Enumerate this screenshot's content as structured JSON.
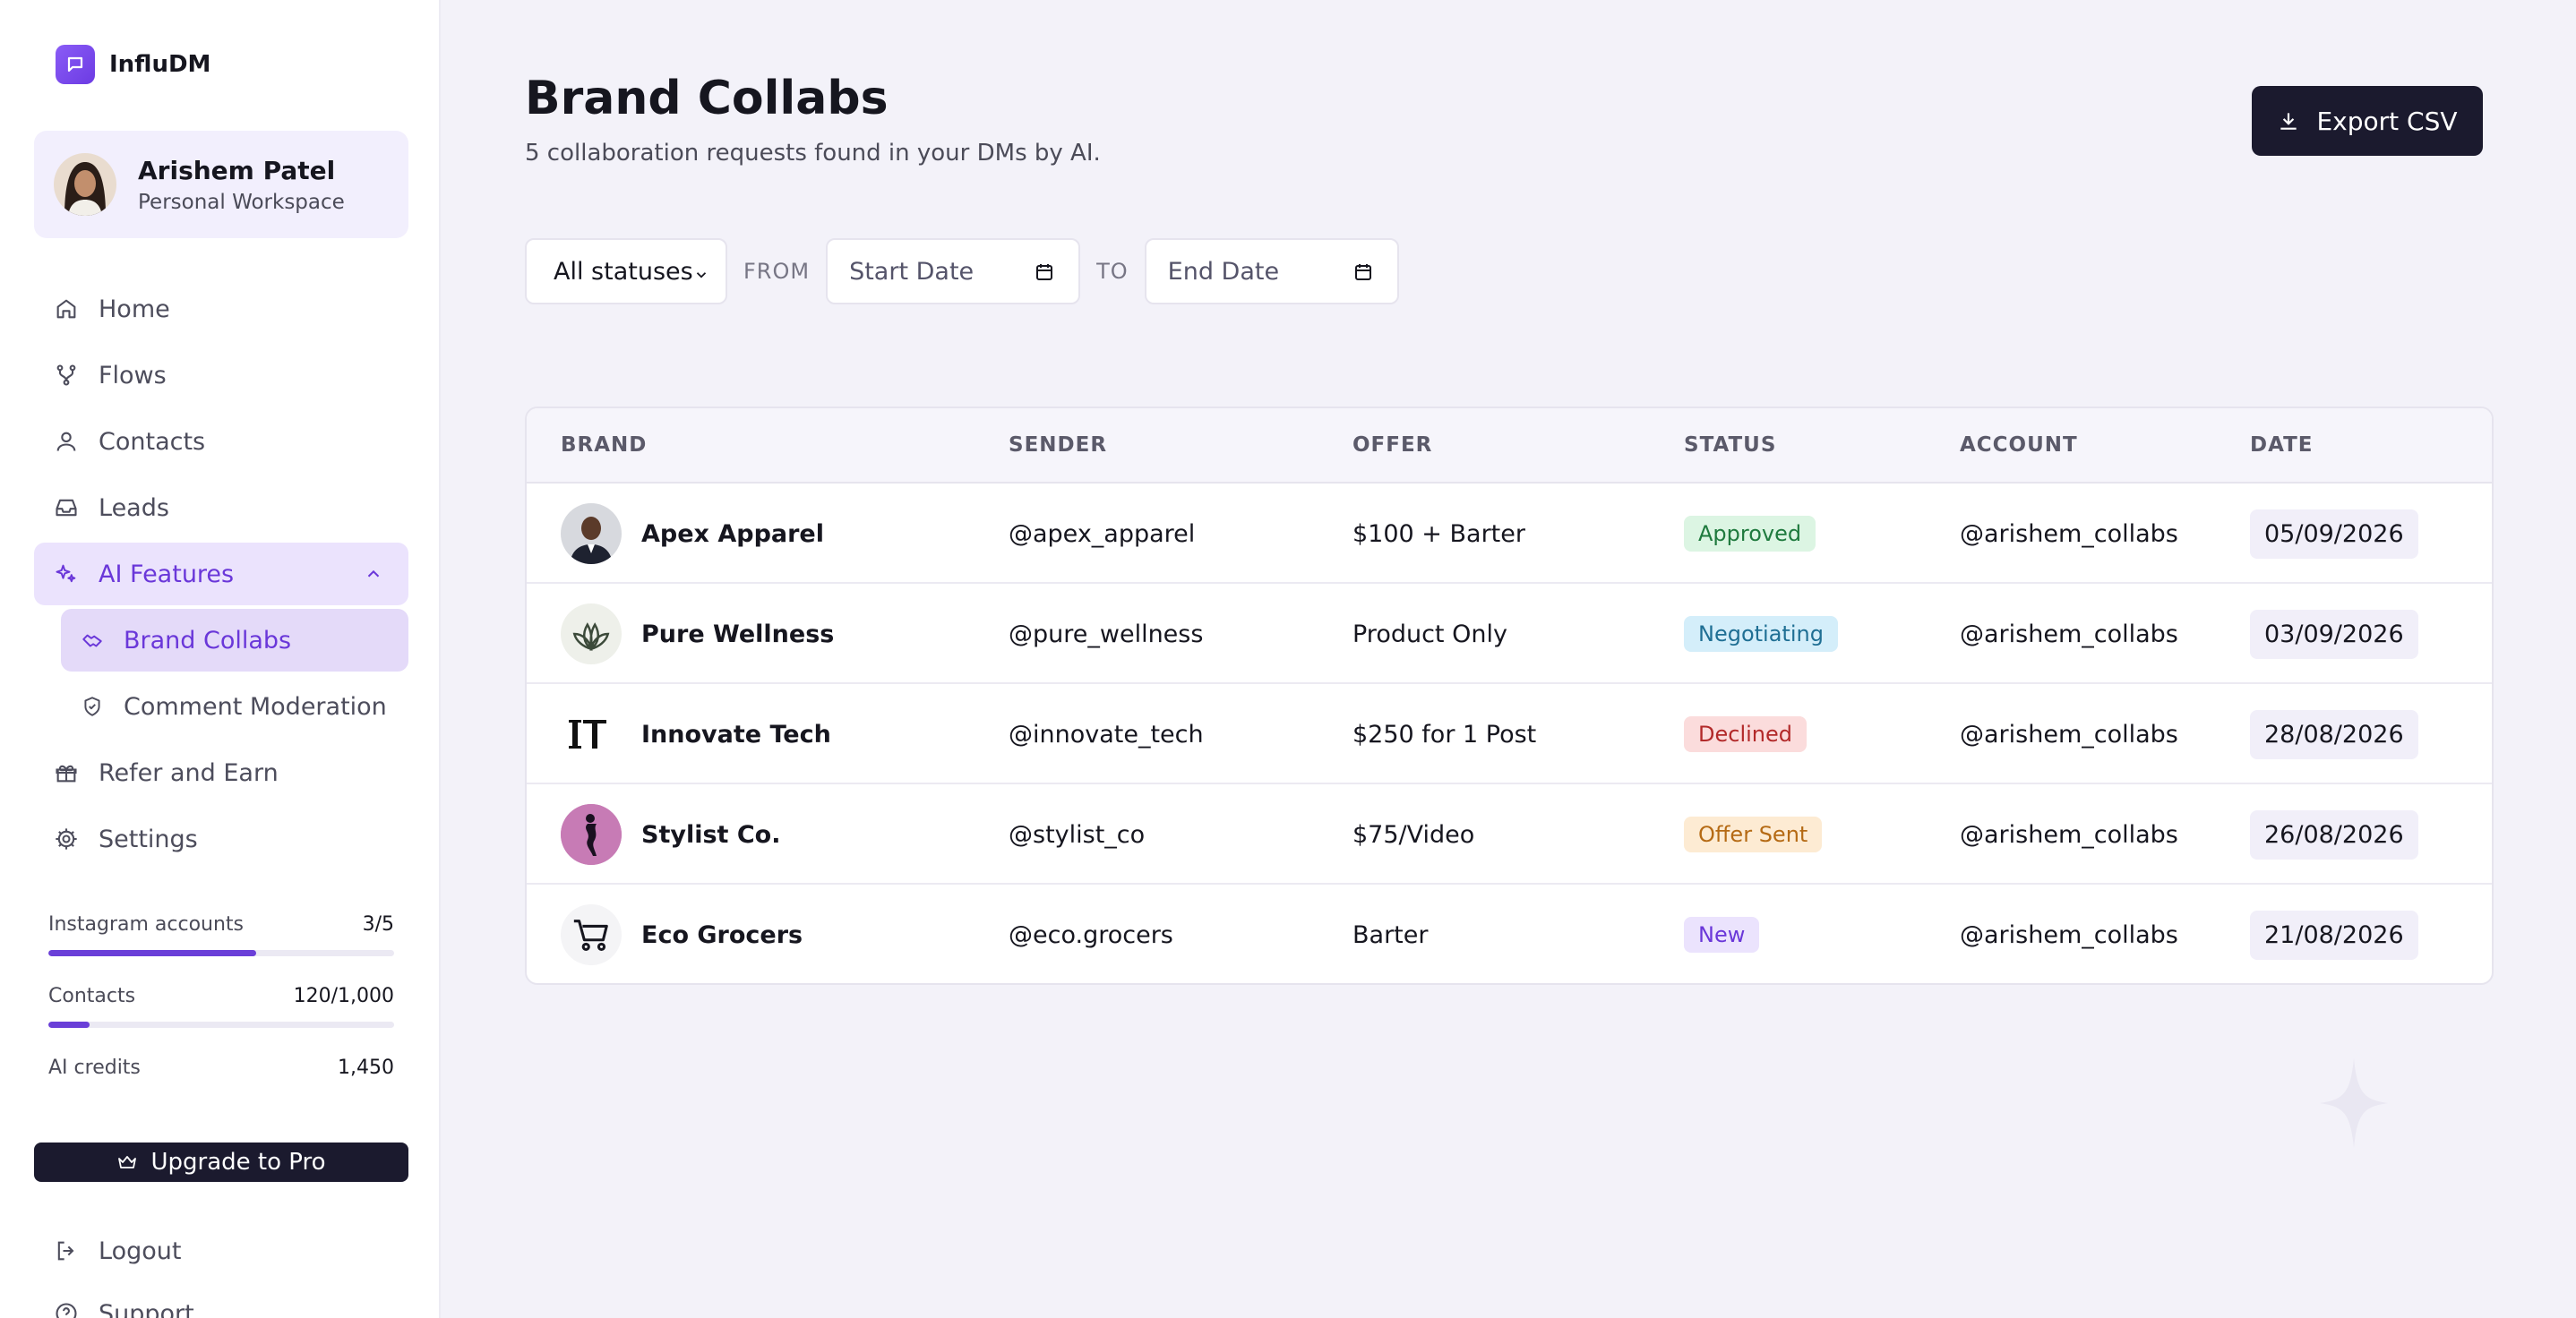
{
  "app": {
    "name": "InfluDM"
  },
  "profile": {
    "name": "Arishem Patel",
    "workspace": "Personal Workspace"
  },
  "nav": {
    "home": "Home",
    "flows": "Flows",
    "contacts": "Contacts",
    "leads": "Leads",
    "ai_features": "AI Features",
    "brand_collabs": "Brand Collabs",
    "comment_moderation": "Comment Moderation",
    "refer": "Refer and Earn",
    "settings": "Settings"
  },
  "usage": {
    "instagram": {
      "label": "Instagram accounts",
      "value": "3/5",
      "fraction": 0.6
    },
    "contacts": {
      "label": "Contacts",
      "value": "120/1,000",
      "fraction": 0.12
    },
    "credits": {
      "label": "AI credits",
      "value": "1,450"
    }
  },
  "upgrade_label": "Upgrade to Pro",
  "bottom_nav": {
    "logout": "Logout",
    "support": "Support"
  },
  "page": {
    "title": "Brand Collabs",
    "subtitle": "5 collaboration requests found in your DMs by AI.",
    "export_label": "Export CSV"
  },
  "filters": {
    "status_selected": "All statuses",
    "from_label": "FROM",
    "to_label": "TO",
    "start_placeholder": "Start Date",
    "end_placeholder": "End Date"
  },
  "table": {
    "headers": {
      "brand": "BRAND",
      "sender": "SENDER",
      "offer": "OFFER",
      "status": "STATUS",
      "account": "ACCOUNT",
      "date": "DATE"
    },
    "rows": [
      {
        "brand": "Apex Apparel",
        "sender": "@apex_apparel",
        "offer": "$100 + Barter",
        "status": "Approved",
        "account": "@arishem_collabs",
        "date": "05/09/2026"
      },
      {
        "brand": "Pure Wellness",
        "sender": "@pure_wellness",
        "offer": "Product Only",
        "status": "Negotiating",
        "account": "@arishem_collabs",
        "date": "03/09/2026"
      },
      {
        "brand": "Innovate Tech",
        "sender": "@innovate_tech",
        "offer": "$250 for 1 Post",
        "status": "Declined",
        "account": "@arishem_collabs",
        "date": "28/08/2026"
      },
      {
        "brand": "Stylist Co.",
        "sender": "@stylist_co",
        "offer": "$75/Video",
        "status": "Offer Sent",
        "account": "@arishem_collabs",
        "date": "26/08/2026"
      },
      {
        "brand": "Eco Grocers",
        "sender": "@eco.grocers",
        "offer": "Barter",
        "status": "New",
        "account": "@arishem_collabs",
        "date": "21/08/2026"
      }
    ]
  },
  "status_colors": {
    "Approved": {
      "bg": "#dcf5e3",
      "fg": "#1f7a3e"
    },
    "Negotiating": {
      "bg": "#d4eefa",
      "fg": "#1f6f94"
    },
    "Declined": {
      "bg": "#fbdcdc",
      "fg": "#b22a2a"
    },
    "Offer Sent": {
      "bg": "#fdebd3",
      "fg": "#b56a14"
    },
    "New": {
      "bg": "#ebe3fd",
      "fg": "#6a37d9"
    }
  },
  "brand_logo_icons": [
    "man-portrait-icon",
    "leaf-icon",
    "it-monogram-icon",
    "figure-silhouette-icon",
    "shopping-cart-icon"
  ]
}
